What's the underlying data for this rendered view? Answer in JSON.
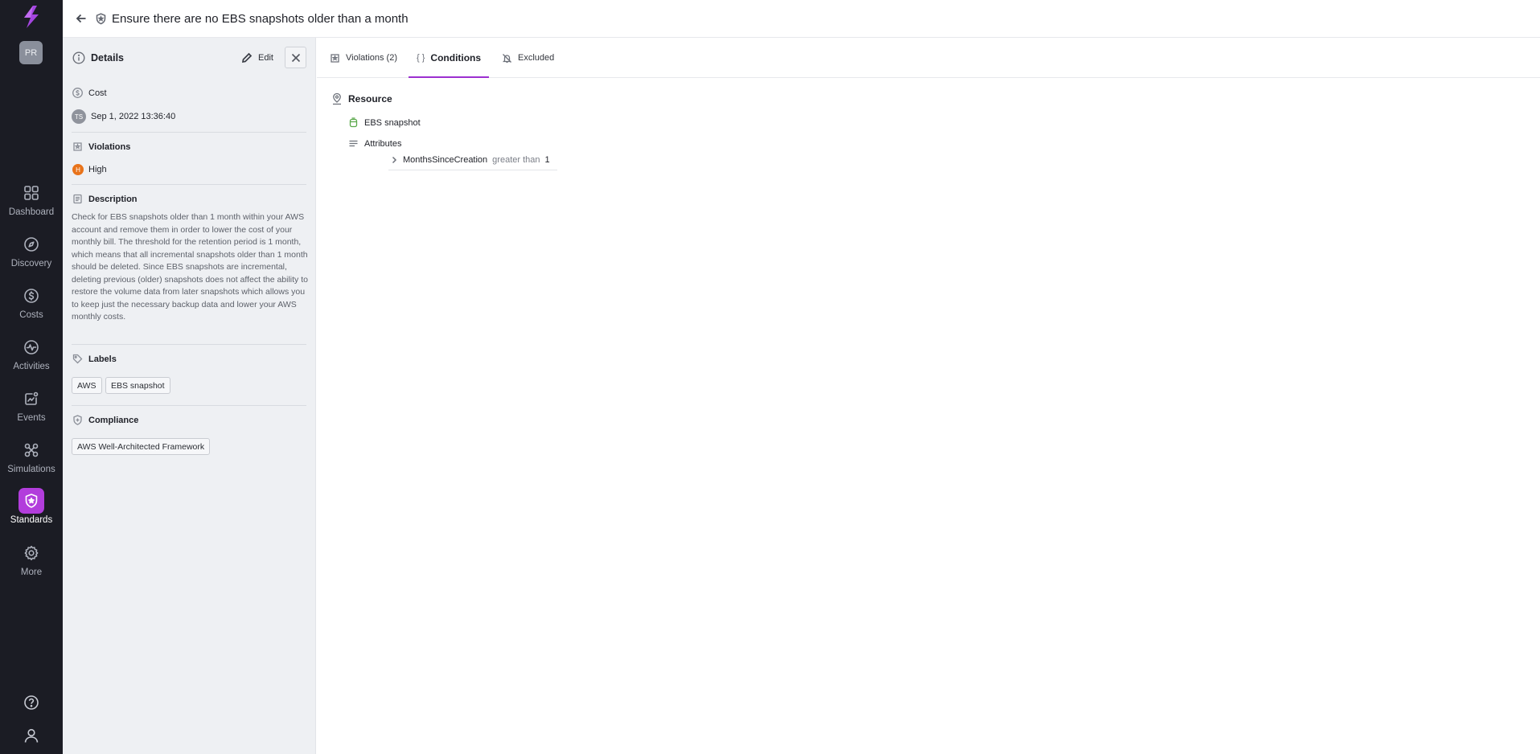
{
  "app": {
    "accent_color": "#b23ddc",
    "user_initials": "PR"
  },
  "nav": {
    "items": [
      {
        "label": "Dashboard",
        "icon": "dashboard-icon"
      },
      {
        "label": "Discovery",
        "icon": "compass-icon"
      },
      {
        "label": "Costs",
        "icon": "dollar-icon"
      },
      {
        "label": "Activities",
        "icon": "activity-icon"
      },
      {
        "label": "Events",
        "icon": "events-icon"
      },
      {
        "label": "Simulations",
        "icon": "simulations-icon"
      },
      {
        "label": "Standards",
        "icon": "shield-icon",
        "active": true
      },
      {
        "label": "More",
        "icon": "gear-icon"
      }
    ],
    "bottom": [
      "help-icon",
      "user-icon"
    ]
  },
  "header": {
    "title": "Ensure there are no EBS snapshots older than a month"
  },
  "details": {
    "title": "Details",
    "edit_label": "Edit",
    "category": "Cost",
    "author_initials": "TS",
    "date": "Sep 1, 2022 13:36:40",
    "violations_label": "Violations",
    "severity_letter": "H",
    "severity": "High",
    "severity_color": "#e8731a",
    "description_label": "Description",
    "description": "Check for EBS snapshots older than 1 month within your AWS account and remove them in order to lower the cost of your monthly bill. The threshold for the retention period is 1 month, which means that all incremental snapshots older than 1 month should be deleted. Since EBS snapshots are incremental, deleting previous (older) snapshots does not affect the ability to restore the volume data from later snapshots which allows you to keep just the necessary backup data and lower your AWS monthly costs.",
    "labels_label": "Labels",
    "labels": [
      "AWS",
      "EBS snapshot"
    ],
    "compliance_label": "Compliance",
    "compliance": [
      "AWS Well-Architected Framework"
    ]
  },
  "tabs": [
    {
      "label": "Violations (2)",
      "icon": "violations-icon"
    },
    {
      "label": "Conditions",
      "icon": "braces-icon",
      "active": true
    },
    {
      "label": "Excluded",
      "icon": "bell-off-icon"
    }
  ],
  "conditions": {
    "resource_label": "Resource",
    "resource_type": "EBS snapshot",
    "attributes_label": "Attributes",
    "attribute": {
      "key": "MonthsSinceCreation",
      "operator": "greater than",
      "value": "1"
    }
  }
}
